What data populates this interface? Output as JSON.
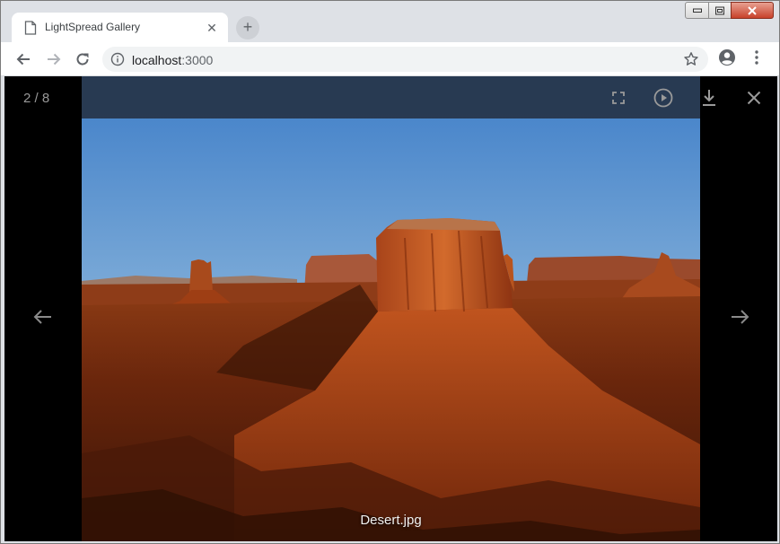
{
  "browser": {
    "tab": {
      "title": "LightSpread Gallery",
      "favicon": "page-icon",
      "close_glyph": "✕"
    },
    "new_tab_glyph": "+",
    "address": {
      "host": "localhost",
      "port": ":3000"
    },
    "icons": [
      "back-icon",
      "forward-icon",
      "reload-icon",
      "info-icon",
      "star-icon",
      "account-icon",
      "menu-icon"
    ]
  },
  "viewer": {
    "counter": "2 / 8",
    "caption": "Desert.jpg",
    "toolbar_icons": [
      "fullscreen-icon",
      "play-icon",
      "download-icon",
      "close-icon"
    ],
    "nav_icons": [
      "prev-arrow-icon",
      "next-arrow-icon"
    ],
    "colors": {
      "backdrop": "#000000",
      "toolbar": "#263448",
      "icon": "#9a9a9a"
    }
  }
}
